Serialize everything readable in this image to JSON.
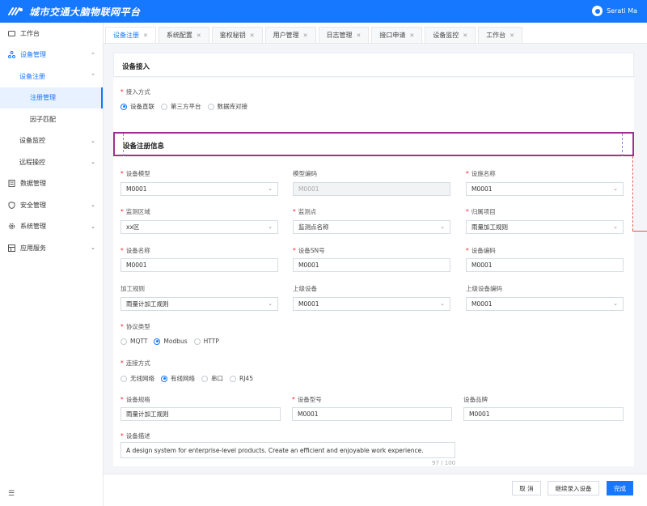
{
  "app": {
    "title": "城市交通大脑物联网平台",
    "user_name": "Serati Ma"
  },
  "sidebar": {
    "items": [
      {
        "label": "工作台",
        "icon": "dashboard-icon"
      },
      {
        "label": "设备管理",
        "icon": "device-icon"
      },
      {
        "label": "设备注册"
      },
      {
        "label": "注册管理"
      },
      {
        "label": "因子匹配"
      },
      {
        "label": "设备监控"
      },
      {
        "label": "远程操控"
      },
      {
        "label": "数据管理",
        "icon": "data-icon"
      },
      {
        "label": "安全管理",
        "icon": "shield-icon"
      },
      {
        "label": "系统管理",
        "icon": "gear-icon"
      },
      {
        "label": "应用服务",
        "icon": "app-icon"
      }
    ]
  },
  "tabs": [
    {
      "label": "设备注册",
      "active": true
    },
    {
      "label": "系统配置"
    },
    {
      "label": "鉴权秘钥"
    },
    {
      "label": "用户管理"
    },
    {
      "label": "日志管理"
    },
    {
      "label": "接口申请"
    },
    {
      "label": "设备监控"
    },
    {
      "label": "工作台"
    }
  ],
  "access": {
    "card_title": "设备接入",
    "method_label": "接入方式",
    "options": [
      "设备直联",
      "第三方平台",
      "数据库对接"
    ],
    "selected": "设备直联"
  },
  "registration": {
    "section_title": "设备注册信息",
    "device_model": {
      "label": "设备模型",
      "value": "M0001"
    },
    "model_code": {
      "label": "模型编码",
      "value": "M0001"
    },
    "facility_name": {
      "label": "设施名称",
      "value": "M0001"
    },
    "monitor_area": {
      "label": "监测区域",
      "value": "xx区"
    },
    "monitor_point": {
      "label": "监测点",
      "value": "监测点名称"
    },
    "project": {
      "label": "归属项目",
      "value": "雨量加工规则"
    },
    "device_name": {
      "label": "设备名称",
      "value": "M0001"
    },
    "device_sn": {
      "label": "设备SN号",
      "value": "M0001"
    },
    "device_code": {
      "label": "设备编码",
      "value": "M0001"
    },
    "processing_rule": {
      "label": "加工规则",
      "value": "雨量计加工规则"
    },
    "parent_device": {
      "label": "上级设备",
      "value": "M0001"
    },
    "parent_device_code": {
      "label": "上级设备编码",
      "value": "M0001"
    },
    "protocol": {
      "label": "协议类型",
      "options": [
        "MQTT",
        "Modbus",
        "HTTP"
      ],
      "selected": "Modbus"
    },
    "connection": {
      "label": "连接方式",
      "options": [
        "无线网络",
        "有线网络",
        "串口",
        "RJ45"
      ],
      "selected": "有线网络"
    },
    "spec": {
      "label": "设备规格",
      "value": "雨量计加工规则"
    },
    "device_type": {
      "label": "设备型号",
      "value": "M0001"
    },
    "brand": {
      "label": "设备品牌",
      "value": "M0001"
    },
    "description": {
      "label": "设备描述",
      "value": "A design system for enterprise-level products. Create an efficient and enjoyable work experience.",
      "counter": "97 / 100"
    }
  },
  "footer": {
    "cancel": "取 消",
    "continue": "继续录入设备",
    "finish": "完成"
  },
  "colors": {
    "primary": "#1677ff",
    "highlight_border": "#a0308f",
    "annotation": "#e0564b"
  }
}
